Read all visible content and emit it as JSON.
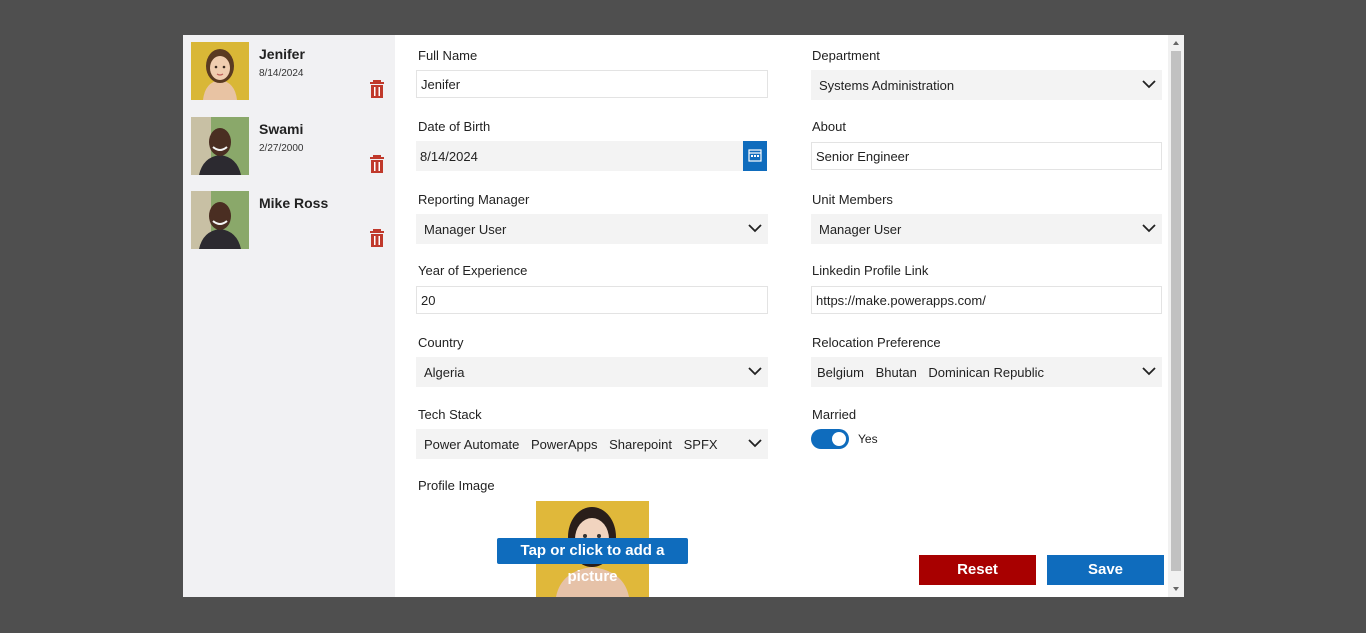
{
  "people": [
    {
      "name": "Jenifer",
      "date": "8/14/2024"
    },
    {
      "name": "Swami",
      "date": "2/27/2000"
    },
    {
      "name": "Mike Ross",
      "date": ""
    }
  ],
  "form": {
    "full_name": {
      "label": "Full Name",
      "value": "Jenifer"
    },
    "department": {
      "label": "Department",
      "value": "Systems Administration"
    },
    "dob": {
      "label": "Date of Birth",
      "value": "8/14/2024"
    },
    "about": {
      "label": "About",
      "value": "Senior Engineer"
    },
    "manager": {
      "label": "Reporting Manager",
      "value": "Manager User"
    },
    "unit_members": {
      "label": "Unit Members",
      "value": "Manager User"
    },
    "experience": {
      "label": "Year of Experience",
      "value": "20"
    },
    "linkedin": {
      "label": "Linkedin Profile Link",
      "value": "https://make.powerapps.com/"
    },
    "country": {
      "label": "Country",
      "value": "Algeria"
    },
    "relocation": {
      "label": "Relocation Preference",
      "values": [
        "Belgium",
        "Bhutan",
        "Dominican Republic"
      ]
    },
    "tech_stack": {
      "label": "Tech Stack",
      "values": [
        "Power Automate",
        "PowerApps",
        "Sharepoint",
        "SPFX"
      ]
    },
    "married": {
      "label": "Married",
      "value": "Yes",
      "on": true
    },
    "profile_image": {
      "label": "Profile Image",
      "overlay": "Tap or click to add a picture"
    }
  },
  "buttons": {
    "reset": "Reset",
    "save": "Save"
  },
  "colors": {
    "accent": "#0f6cbd",
    "danger": "#a80000",
    "background": "#4f4f4f"
  }
}
